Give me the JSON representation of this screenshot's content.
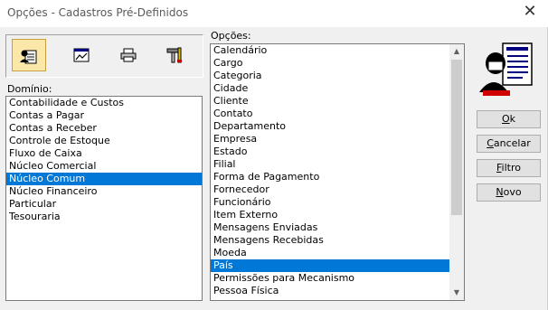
{
  "window": {
    "title": "Opções - Cadastros Pré-Definidos",
    "close_glyph": "✕"
  },
  "toolbar": {
    "buttons": [
      {
        "icon": "user-card-icon",
        "active": true
      },
      {
        "icon": "chart-window-icon",
        "active": false
      },
      {
        "icon": "printer-icon",
        "active": false
      },
      {
        "icon": "tools-icon",
        "active": false
      }
    ]
  },
  "dominio": {
    "label": "Domínio:",
    "items": [
      "Contabilidade e Custos",
      "Contas a Pagar",
      "Contas a Receber",
      "Controle de Estoque",
      "Fluxo de Caixa",
      "Núcleo Comercial",
      "Núcleo Comum",
      "Núcleo Financeiro",
      "Particular",
      "Tesouraria"
    ],
    "selected": "Núcleo Comum"
  },
  "opcoes": {
    "label": "Opções:",
    "items": [
      "Calendário",
      "Cargo",
      "Categoria",
      "Cidade",
      "Cliente",
      "Contato",
      "Departamento",
      "Empresa",
      "Estado",
      "Filial",
      "Forma de Pagamento",
      "Fornecedor",
      "Funcionário",
      "Item Externo",
      "Mensagens Enviadas",
      "Mensagens Recebidas",
      "Moeda",
      "País",
      "Permissões para Mecanismo",
      "Pessoa Física"
    ],
    "selected": "País"
  },
  "buttons": {
    "ok": {
      "accel": "O",
      "rest": "k"
    },
    "cancelar": {
      "accel": "C",
      "rest": "ancelar"
    },
    "filtro": {
      "accel": "F",
      "rest": "iltro"
    },
    "novo": {
      "accel": "N",
      "rest": "ovo"
    }
  }
}
